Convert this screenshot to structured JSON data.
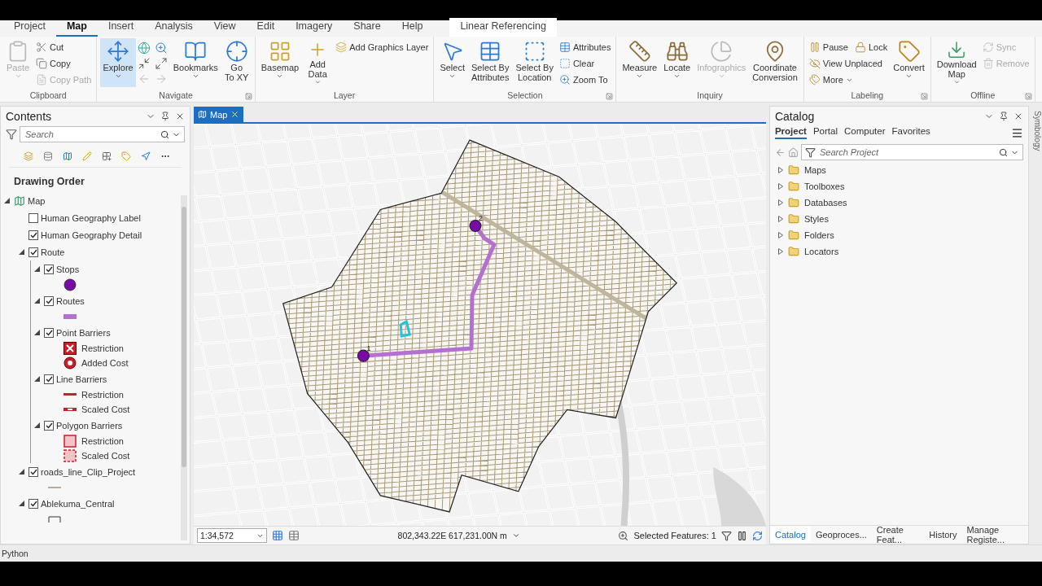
{
  "ribbon": {
    "tabs": [
      {
        "label": "Project",
        "selected": false,
        "kind": "normal"
      },
      {
        "label": "Map",
        "selected": true,
        "kind": "normal"
      },
      {
        "label": "Insert",
        "selected": false,
        "kind": "normal"
      },
      {
        "label": "Analysis",
        "selected": false,
        "kind": "normal"
      },
      {
        "label": "View",
        "selected": false,
        "kind": "normal"
      },
      {
        "label": "Edit",
        "selected": false,
        "kind": "normal"
      },
      {
        "label": "Imagery",
        "selected": false,
        "kind": "normal"
      },
      {
        "label": "Share",
        "selected": false,
        "kind": "normal"
      },
      {
        "label": "Help",
        "selected": false,
        "kind": "normal"
      },
      {
        "label": "Linear Referencing",
        "selected": false,
        "kind": "contextual"
      }
    ],
    "groups": [
      {
        "name": "Clipboard",
        "launcher": false,
        "tools": [
          {
            "kind": "large",
            "label": "Paste",
            "disabled": true,
            "dropdown": true,
            "selected": false
          },
          {
            "kind": "stack",
            "rows": [
              [
                {
                  "label": "Cut",
                  "disabled": false
                }
              ],
              [
                {
                  "label": "Copy",
                  "disabled": false
                }
              ],
              [
                {
                  "label": "Copy Path",
                  "disabled": true
                }
              ]
            ]
          }
        ]
      },
      {
        "name": "Navigate",
        "launcher": true,
        "tools": [
          {
            "kind": "large",
            "label": "Explore",
            "disabled": false,
            "dropdown": true,
            "selected": true
          },
          {
            "kind": "navgrid"
          },
          {
            "kind": "large",
            "label": "Bookmarks",
            "disabled": false,
            "dropdown": true,
            "selected": false
          },
          {
            "kind": "large",
            "label": "Go\nTo XY",
            "disabled": false,
            "dropdown": false,
            "selected": false
          }
        ]
      },
      {
        "name": "Layer",
        "launcher": false,
        "tools": [
          {
            "kind": "large",
            "label": "Basemap",
            "disabled": false,
            "dropdown": true,
            "selected": false
          },
          {
            "kind": "large",
            "label": "Add\nData",
            "disabled": false,
            "dropdown": true,
            "selected": false
          },
          {
            "kind": "stack",
            "rows": [
              [
                {
                  "label": "Add Graphics Layer",
                  "disabled": false
                }
              ]
            ]
          }
        ]
      },
      {
        "name": "Selection",
        "launcher": true,
        "tools": [
          {
            "kind": "large",
            "label": "Select",
            "disabled": false,
            "dropdown": true,
            "selected": false
          },
          {
            "kind": "large",
            "label": "Select By\nAttributes",
            "disabled": false,
            "dropdown": false,
            "selected": false
          },
          {
            "kind": "large",
            "label": "Select By\nLocation",
            "disabled": false,
            "dropdown": false,
            "selected": false
          },
          {
            "kind": "stack",
            "rows": [
              [
                {
                  "label": "Attributes",
                  "disabled": false
                }
              ],
              [
                {
                  "label": "Clear",
                  "disabled": false
                }
              ],
              [
                {
                  "label": "Zoom To",
                  "disabled": false
                }
              ]
            ]
          }
        ]
      },
      {
        "name": "Inquiry",
        "launcher": false,
        "tools": [
          {
            "kind": "large",
            "label": "Measure",
            "disabled": false,
            "dropdown": true,
            "selected": false
          },
          {
            "kind": "large",
            "label": "Locate",
            "disabled": false,
            "dropdown": true,
            "selected": false
          },
          {
            "kind": "large",
            "label": "Infographics",
            "disabled": true,
            "dropdown": true,
            "selected": false
          },
          {
            "kind": "large",
            "label": "Coordinate\nConversion",
            "disabled": false,
            "dropdown": false,
            "selected": false
          }
        ]
      },
      {
        "name": "Labeling",
        "launcher": true,
        "tools": [
          {
            "kind": "stack",
            "rows": [
              [
                {
                  "label": "Pause",
                  "disabled": false
                },
                {
                  "label": "Lock",
                  "disabled": false
                }
              ],
              [
                {
                  "label": "View Unplaced",
                  "disabled": false
                }
              ],
              [
                {
                  "label": "More",
                  "disabled": false,
                  "dropdown": true
                }
              ]
            ]
          },
          {
            "kind": "large",
            "label": "Convert",
            "disabled": false,
            "dropdown": true,
            "selected": false
          }
        ]
      },
      {
        "name": "Offline",
        "launcher": true,
        "tools": [
          {
            "kind": "large",
            "label": "Download\nMap",
            "disabled": false,
            "dropdown": true,
            "selected": false
          },
          {
            "kind": "stack",
            "rows": [
              [
                {
                  "label": "Sync",
                  "disabled": true
                }
              ],
              [
                {
                  "label": "Remove",
                  "disabled": true
                }
              ]
            ]
          }
        ]
      }
    ]
  },
  "contents": {
    "title": "Contents",
    "search": {
      "placeholder": "Search"
    },
    "heading": "Drawing Order",
    "tree": [
      {
        "kind": "map",
        "label": "Map",
        "expanded": true,
        "children": [
          {
            "kind": "layer",
            "label": "Human Geography Label",
            "checked": false
          },
          {
            "kind": "layer",
            "label": "Human Geography Detail",
            "checked": true
          },
          {
            "kind": "layer",
            "label": "Route",
            "checked": true,
            "expanded": true,
            "children": [
              {
                "kind": "layer",
                "label": "Stops",
                "checked": true,
                "expanded": true,
                "children": [
                  {
                    "kind": "dot"
                  }
                ]
              },
              {
                "kind": "layer",
                "label": "Routes",
                "checked": true,
                "expanded": true,
                "children": [
                  {
                    "kind": "bar"
                  }
                ]
              },
              {
                "kind": "layer",
                "label": "Point Barriers",
                "checked": true,
                "expanded": true,
                "children": [
                  {
                    "kind": "x-square",
                    "label": "Restriction"
                  },
                  {
                    "kind": "ring",
                    "label": "Added Cost"
                  }
                ]
              },
              {
                "kind": "layer",
                "label": "Line Barriers",
                "checked": true,
                "expanded": true,
                "children": [
                  {
                    "kind": "line",
                    "label": "Restriction"
                  },
                  {
                    "kind": "dash-line",
                    "label": "Scaled Cost"
                  }
                ]
              },
              {
                "kind": "layer",
                "label": "Polygon Barriers",
                "checked": true,
                "expanded": true,
                "children": [
                  {
                    "kind": "square",
                    "label": "Restriction"
                  },
                  {
                    "kind": "dash-square",
                    "label": "Scaled Cost"
                  }
                ]
              }
            ]
          },
          {
            "kind": "layer",
            "label": "roads_line_Clip_Project",
            "checked": true,
            "expanded": true,
            "children": [
              {
                "kind": "road-line"
              }
            ]
          },
          {
            "kind": "layer",
            "label": "Ablekuma_Central",
            "checked": true,
            "expanded": true,
            "children": [
              {
                "kind": "outline"
              }
            ]
          }
        ]
      }
    ]
  },
  "map_view": {
    "tab": {
      "label": "Map",
      "selected": true
    },
    "stops": [
      {
        "label": "1"
      },
      {
        "label": "2"
      }
    ],
    "scale": "1:34,572",
    "coordinates": "802,343.22E 617,231.00N m",
    "selected_features": "Selected Features: 1"
  },
  "catalog": {
    "title": "Catalog",
    "tabs": [
      {
        "label": "Project",
        "selected": true
      },
      {
        "label": "Portal",
        "selected": false
      },
      {
        "label": "Computer",
        "selected": false
      },
      {
        "label": "Favorites",
        "selected": false
      }
    ],
    "search": {
      "placeholder": "Search Project"
    },
    "items": [
      {
        "label": "Maps",
        "expanded": false
      },
      {
        "label": "Toolboxes",
        "expanded": false
      },
      {
        "label": "Databases",
        "expanded": false
      },
      {
        "label": "Styles",
        "expanded": false
      },
      {
        "label": "Folders",
        "expanded": false
      },
      {
        "label": "Locators",
        "expanded": false
      }
    ],
    "bottom_tabs": [
      {
        "label": "Catalog",
        "selected": true
      },
      {
        "label": "Geoproces...",
        "selected": false
      },
      {
        "label": "Create Feat...",
        "selected": false
      },
      {
        "label": "History",
        "selected": false
      },
      {
        "label": "Manage Registe...",
        "selected": false
      }
    ]
  },
  "side_tab": "Symbology",
  "status_bar": {
    "label": "Python"
  }
}
